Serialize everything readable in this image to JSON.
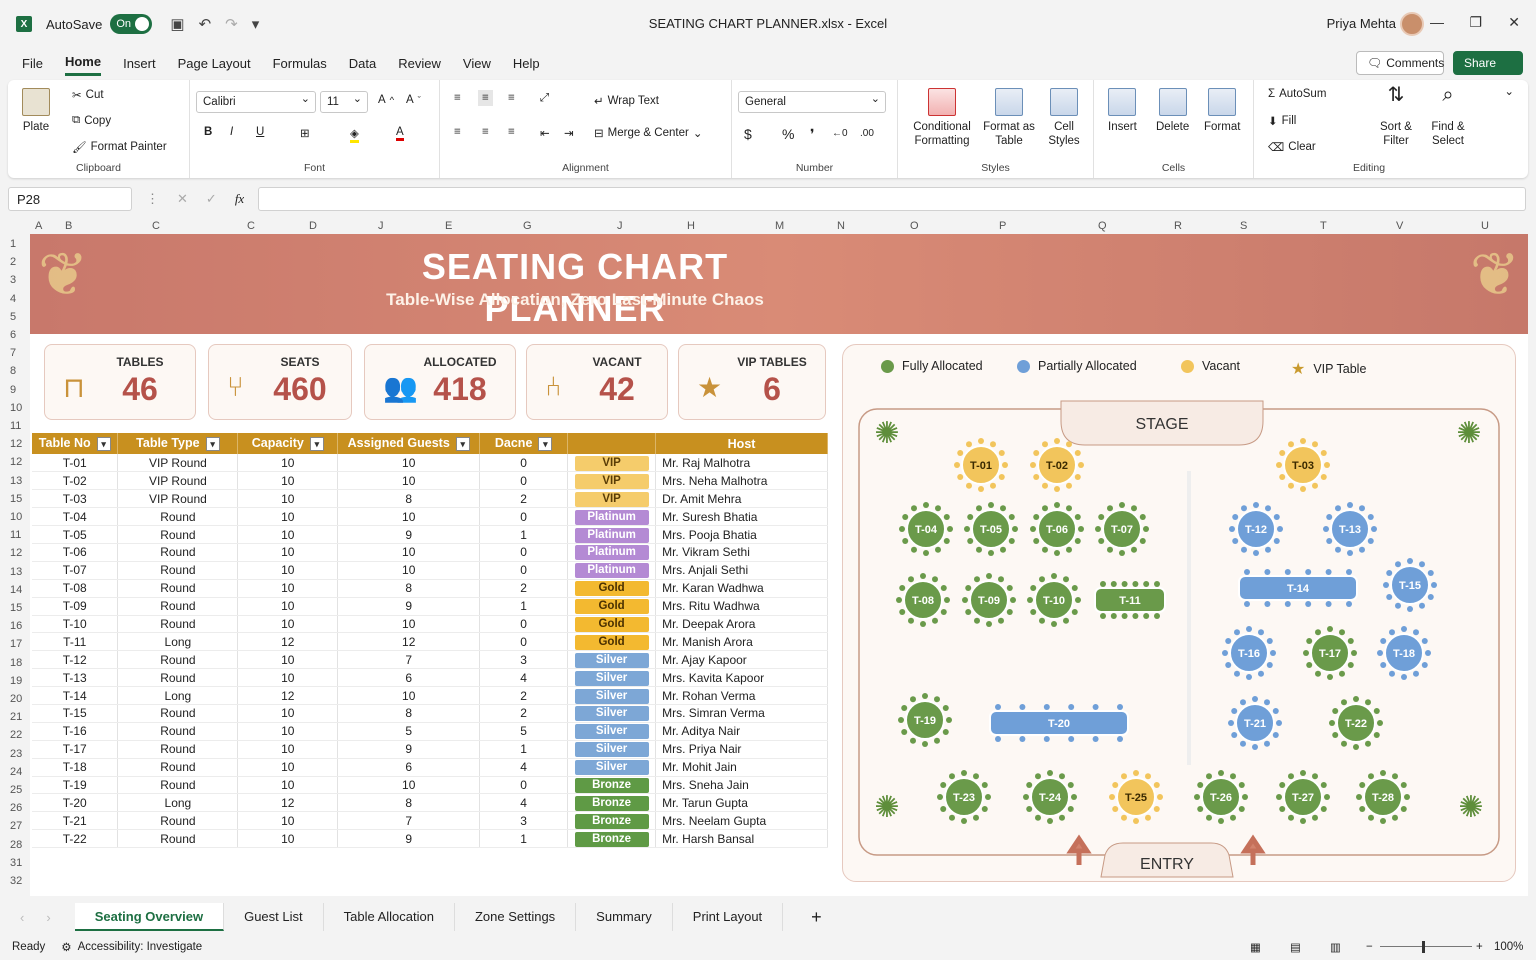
{
  "app": {
    "autosave_label": "AutoSave",
    "autosave_state": "On",
    "title": "SEATING CHART PLANNER.xlsx  -  Excel",
    "user": "Priya Mehta"
  },
  "ribbon_tabs": [
    "File",
    "Home",
    "Insert",
    "Page Layout",
    "Formulas",
    "Data",
    "Review",
    "View",
    "Help"
  ],
  "active_tab": "Home",
  "top_buttons": {
    "comments": "Comments",
    "share": "Share"
  },
  "ribbon": {
    "clipboard": {
      "paste": "Plate",
      "cut": "Cut",
      "copy": "Copy",
      "format_painter": "Format Painter",
      "label": "Clipboard"
    },
    "font": {
      "family": "Calibri",
      "size": "11",
      "label": "Font"
    },
    "alignment": {
      "wrap": "Wrap Text",
      "merge": "Merge & Center",
      "label": "Alignment"
    },
    "number": {
      "format": "General",
      "label": "Number"
    },
    "styles": {
      "conditional": "Conditional Formatting",
      "format_table": "Format as Table",
      "cell_styles": "Cell Styles",
      "label": "Styles"
    },
    "cells": {
      "insert": "Insert",
      "delete": "Delete",
      "format": "Format",
      "label": "Cells"
    },
    "editing": {
      "autosum": "AutoSum",
      "fill": "Fill",
      "clear": "Clear",
      "sort": "Sort & Filter",
      "find": "Find & Select",
      "label": "Editing"
    }
  },
  "name_box": "P28",
  "fx": "fx",
  "columns": [
    "A",
    "B",
    "C",
    "C",
    "D",
    "J",
    "E",
    "G",
    "J",
    "H",
    "M",
    "N",
    "O",
    "P",
    "Q",
    "R",
    "S",
    "T",
    "V",
    "U"
  ],
  "rows": [
    "1",
    "2",
    "3",
    "4",
    "5",
    "6",
    "7",
    "8",
    "9",
    "10",
    "11",
    "12",
    "12",
    "13",
    "15",
    "10",
    "11",
    "12",
    "13",
    "14",
    "15",
    "16",
    "17",
    "18",
    "19",
    "20",
    "21",
    "22",
    "23",
    "24",
    "25",
    "26",
    "27",
    "28",
    "31",
    "32"
  ],
  "banner": {
    "title": "SEATING CHART PLANNER",
    "subtitle": "Table-Wise Allocation, Zero Last-Minute Chaos"
  },
  "kpis": [
    {
      "label": "TABLES",
      "value": "46",
      "icon": "table-icon"
    },
    {
      "label": "SEATS",
      "value": "460",
      "icon": "chairs-icon"
    },
    {
      "label": "ALLOCATED",
      "value": "418",
      "icon": "people-icon"
    },
    {
      "label": "VACANT",
      "value": "42",
      "icon": "chair-icon"
    },
    {
      "label": "VIP TABLES",
      "value": "6",
      "icon": "star-icon"
    }
  ],
  "table": {
    "headers": [
      "Table No",
      "Table Type",
      "Capacity",
      "Assigned Guests",
      "Dacne",
      "",
      "Host"
    ],
    "rows": [
      [
        "T-01",
        "VIP Round",
        "10",
        "10",
        "0",
        "VIP",
        "Mr. Raj Malhotra"
      ],
      [
        "T-02",
        "VIP Round",
        "10",
        "10",
        "0",
        "VIP",
        "Mrs. Neha Malhotra"
      ],
      [
        "T-03",
        "VIP Round",
        "10",
        "8",
        "2",
        "VIP",
        "Dr. Amit Mehra"
      ],
      [
        "T-04",
        "Round",
        "10",
        "10",
        "0",
        "Platinum",
        "Mr. Suresh Bhatia"
      ],
      [
        "T-05",
        "Round",
        "10",
        "9",
        "1",
        "Platinum",
        "Mrs. Pooja Bhatia"
      ],
      [
        "T-06",
        "Round",
        "10",
        "10",
        "0",
        "Platinum",
        "Mr. Vikram Sethi"
      ],
      [
        "T-07",
        "Round",
        "10",
        "10",
        "0",
        "Platinum",
        "Mrs. Anjali Sethi"
      ],
      [
        "T-08",
        "Round",
        "10",
        "8",
        "2",
        "Gold",
        "Mr. Karan Wadhwa"
      ],
      [
        "T-09",
        "Round",
        "10",
        "9",
        "1",
        "Gold",
        "Mrs. Ritu Wadhwa"
      ],
      [
        "T-10",
        "Round",
        "10",
        "10",
        "0",
        "Gold",
        "Mr. Deepak Arora"
      ],
      [
        "T-11",
        "Long",
        "12",
        "12",
        "0",
        "Gold",
        "Mr. Manish Arora"
      ],
      [
        "T-12",
        "Round",
        "10",
        "7",
        "3",
        "Silver",
        "Mr. Ajay Kapoor"
      ],
      [
        "T-13",
        "Round",
        "10",
        "6",
        "4",
        "Silver",
        "Mrs. Kavita Kapoor"
      ],
      [
        "T-14",
        "Long",
        "12",
        "10",
        "2",
        "Silver",
        "Mr. Rohan Verma"
      ],
      [
        "T-15",
        "Round",
        "10",
        "8",
        "2",
        "Silver",
        "Mrs. Simran Verma"
      ],
      [
        "T-16",
        "Round",
        "10",
        "5",
        "5",
        "Silver",
        "Mr. Aditya Nair"
      ],
      [
        "T-17",
        "Round",
        "10",
        "9",
        "1",
        "Silver",
        "Mrs. Priya Nair"
      ],
      [
        "T-18",
        "Round",
        "10",
        "6",
        "4",
        "Silver",
        "Mr. Mohit Jain"
      ],
      [
        "T-19",
        "Round",
        "10",
        "10",
        "0",
        "Bronze",
        "Mrs. Sneha Jain"
      ],
      [
        "T-20",
        "Long",
        "12",
        "8",
        "4",
        "Bronze",
        "Mr. Tarun Gupta"
      ],
      [
        "T-21",
        "Round",
        "10",
        "7",
        "3",
        "Bronze",
        "Mrs. Neelam Gupta"
      ],
      [
        "T-22",
        "Round",
        "10",
        "9",
        "1",
        "Bronze",
        "Mr. Harsh Bansal"
      ]
    ]
  },
  "legend": [
    {
      "label": "Fully Allocated",
      "color": "#6a9a4a"
    },
    {
      "label": "Partially Allocated",
      "color": "#6f9fd8"
    },
    {
      "label": "Vacant",
      "color": "#f2c55c"
    },
    {
      "label": "VIP Table",
      "color": "#c99a2e"
    }
  ],
  "floor": {
    "stage": "STAGE",
    "entry": "ENTRY",
    "tables": [
      {
        "id": "T-01",
        "status": "vacant"
      },
      {
        "id": "T-02",
        "status": "vacant"
      },
      {
        "id": "T-03",
        "status": "vacant"
      },
      {
        "id": "T-04",
        "status": "full"
      },
      {
        "id": "T-05",
        "status": "full"
      },
      {
        "id": "T-06",
        "status": "full"
      },
      {
        "id": "T-07",
        "status": "full"
      },
      {
        "id": "T-12",
        "status": "partial"
      },
      {
        "id": "T-13",
        "status": "partial"
      },
      {
        "id": "T-08",
        "status": "full"
      },
      {
        "id": "T-09",
        "status": "full"
      },
      {
        "id": "T-10",
        "status": "full"
      },
      {
        "id": "T-11",
        "status": "full",
        "long": true
      },
      {
        "id": "T-14",
        "status": "partial",
        "long": true
      },
      {
        "id": "T-15",
        "status": "partial"
      },
      {
        "id": "T-16",
        "status": "partial"
      },
      {
        "id": "T-17",
        "status": "full"
      },
      {
        "id": "T-18",
        "status": "partial"
      },
      {
        "id": "T-19",
        "status": "full"
      },
      {
        "id": "T-20",
        "status": "partial",
        "long": true
      },
      {
        "id": "T-21",
        "status": "partial"
      },
      {
        "id": "T-22",
        "status": "full"
      },
      {
        "id": "T-23",
        "status": "full"
      },
      {
        "id": "T-24",
        "status": "full"
      },
      {
        "id": "T-25",
        "status": "vacant"
      },
      {
        "id": "T-26",
        "status": "full"
      },
      {
        "id": "T-27",
        "status": "full"
      },
      {
        "id": "T-28",
        "status": "full"
      }
    ]
  },
  "sheet_tabs": [
    "Seating Overview",
    "Guest List",
    "Table Allocation",
    "Zone Settings",
    "Summary",
    "Print Layout"
  ],
  "active_sheet": "Seating Overview",
  "status": {
    "ready": "Ready",
    "accessibility": "Accessibility: Investigate",
    "zoom": "100%"
  },
  "colors": {
    "full": "#6a9a4a",
    "partial": "#6f9fd8",
    "vacant": "#f2c55c"
  }
}
